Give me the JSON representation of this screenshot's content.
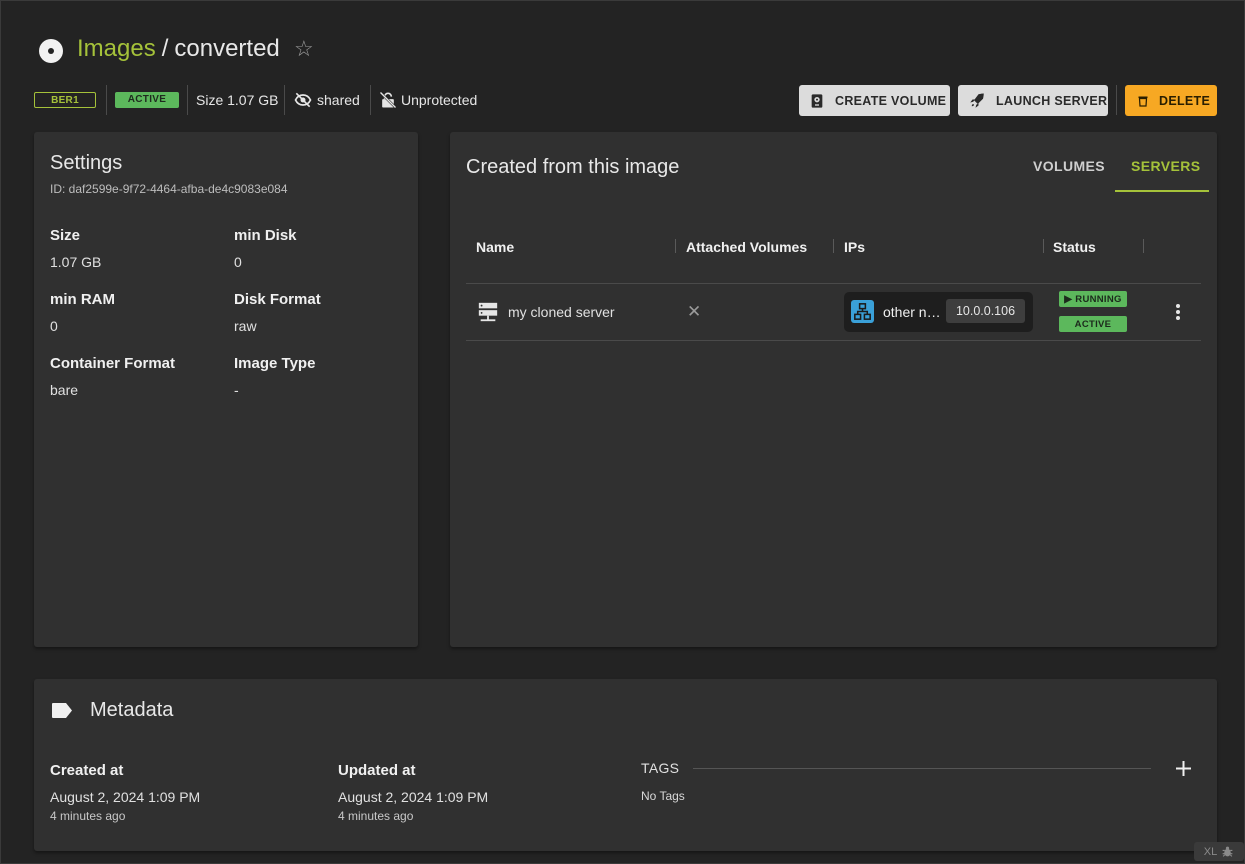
{
  "header": {
    "breadcrumb_parent": "Images",
    "separator": "/",
    "image_name": "converted",
    "star_glyph": "☆"
  },
  "info": {
    "region": "BER1",
    "status": "ACTIVE",
    "size": "Size 1.07 GB",
    "visibility": "shared",
    "protection": "Unprotected"
  },
  "actions": {
    "create_volume": "CREATE VOLUME",
    "launch_server": "LAUNCH SERVER",
    "delete": "DELETE"
  },
  "settings": {
    "title": "Settings",
    "id": "ID: daf2599e-9f72-4464-afba-de4c9083e084",
    "fields": [
      {
        "label": "Size",
        "value": "1.07 GB"
      },
      {
        "label": "min Disk",
        "value": "0"
      },
      {
        "label": "min RAM",
        "value": "0"
      },
      {
        "label": "Disk Format",
        "value": "raw"
      },
      {
        "label": "Container Format",
        "value": "bare"
      },
      {
        "label": "Image Type",
        "value": "-"
      }
    ]
  },
  "created": {
    "title": "Created from this image",
    "tabs": [
      "VOLUMES",
      "SERVERS"
    ],
    "active_tab": "SERVERS",
    "columns": [
      "Name",
      "Attached Volumes",
      "IPs",
      "Status"
    ],
    "rows": [
      {
        "name": "my cloned server",
        "attached_volumes": "✕",
        "network": "other n…",
        "ip": "10.0.0.106",
        "power_state": "RUNNING",
        "state": "ACTIVE"
      }
    ]
  },
  "metadata": {
    "title": "Metadata",
    "created_label": "Created at",
    "created_value": "August 2, 2024 1:09 PM",
    "created_ago": "4 minutes ago",
    "updated_label": "Updated at",
    "updated_value": "August 2, 2024 1:09 PM",
    "updated_ago": "4 minutes ago",
    "tags_label": "TAGS",
    "no_tags": "No Tags"
  },
  "footer": {
    "size_badge": "XL"
  },
  "colors": {
    "accent": "#a5c23a",
    "active_green": "#5cb85c",
    "delete_orange": "#f7a823",
    "background": "#232323",
    "card": "#303030"
  }
}
